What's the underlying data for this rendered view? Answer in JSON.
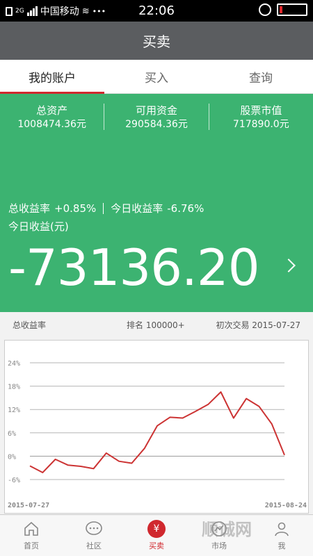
{
  "status_bar": {
    "network_type": "2G",
    "carrier": "中国移动",
    "more": "•••",
    "time": "22:06"
  },
  "title": "买卖",
  "tabs": [
    {
      "label": "我的账户",
      "active": true
    },
    {
      "label": "买入",
      "active": false
    },
    {
      "label": "查询",
      "active": false
    }
  ],
  "account": {
    "stats": [
      {
        "label": "总资产",
        "value": "1008474.36元"
      },
      {
        "label": "可用资金",
        "value": "290584.36元"
      },
      {
        "label": "股票市值",
        "value": "717890.0元"
      }
    ],
    "total_return_label": "总收益率",
    "total_return_value": "+0.85%",
    "today_return_label": "今日收益率",
    "today_return_value": "-6.76%",
    "today_profit_label": "今日收益(元)",
    "today_profit_value": "-73136.20",
    "panel_color": "#3cb371"
  },
  "chart_header": {
    "label": "总收益率",
    "rank": "排名 100000+",
    "first_trade": "初次交易 2015-07-27"
  },
  "chart_data": {
    "type": "line",
    "title": "",
    "xlabel": "",
    "ylabel": "",
    "y_ticks": [
      "24%",
      "18%",
      "12%",
      "6%",
      "0%",
      "-6%"
    ],
    "ylim": [
      -6,
      24
    ],
    "x_start_label": "2015-07-27",
    "x_end_label": "2015-08-24",
    "grid": true,
    "line_color": "#cc3333",
    "values": [
      -2.5,
      -4.2,
      -0.8,
      -2.3,
      -2.6,
      -3.2,
      0.8,
      -1.3,
      -1.8,
      2.0,
      7.8,
      10.0,
      9.8,
      11.5,
      13.3,
      16.5,
      9.8,
      14.8,
      12.8,
      8.3,
      0.3
    ]
  },
  "bottom_nav": [
    {
      "label": "首页",
      "icon": "home-icon",
      "active": false
    },
    {
      "label": "社区",
      "icon": "chat-bubble-icon",
      "active": false
    },
    {
      "label": "买卖",
      "icon": "yen-icon",
      "active": true
    },
    {
      "label": "市场",
      "icon": "chart-icon",
      "active": false
    },
    {
      "label": "我",
      "icon": "person-icon",
      "active": false
    }
  ],
  "watermark_text": "顺诚网"
}
